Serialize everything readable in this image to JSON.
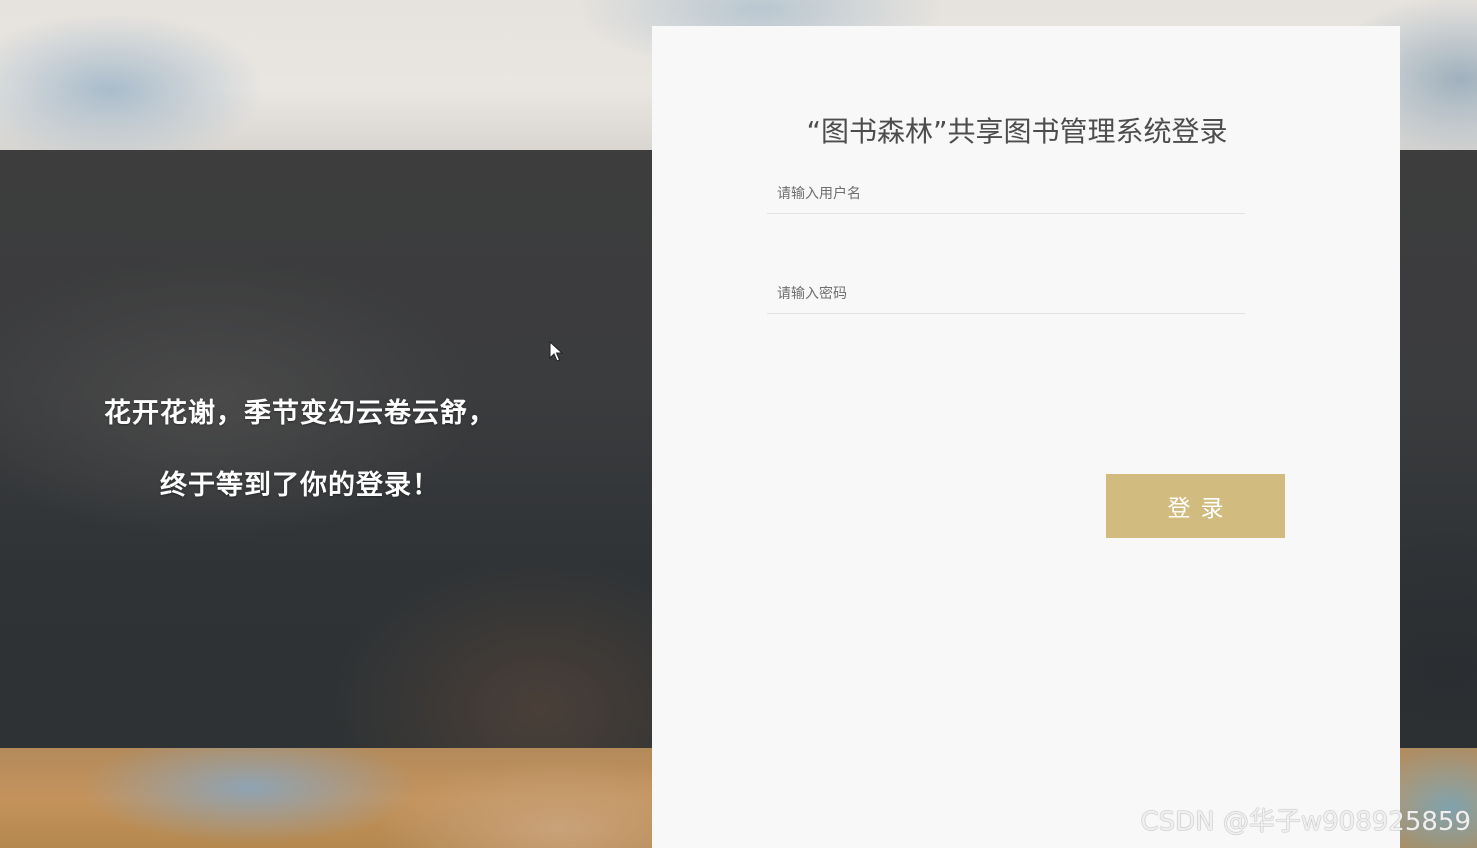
{
  "left": {
    "slogan_line1": "花开花谢，季节变幻云卷云舒，",
    "slogan_line2": "终于等到了你的登录！"
  },
  "login": {
    "title": "“图书森林”共享图书管理系统登录",
    "username_placeholder": "请输入用户名",
    "password_placeholder": "请输入密码",
    "submit_label": "登录",
    "button_color": "#d1bb7f"
  },
  "watermark": "CSDN @华子w908925859",
  "icons": {
    "cursor": "mouse-pointer-icon"
  }
}
